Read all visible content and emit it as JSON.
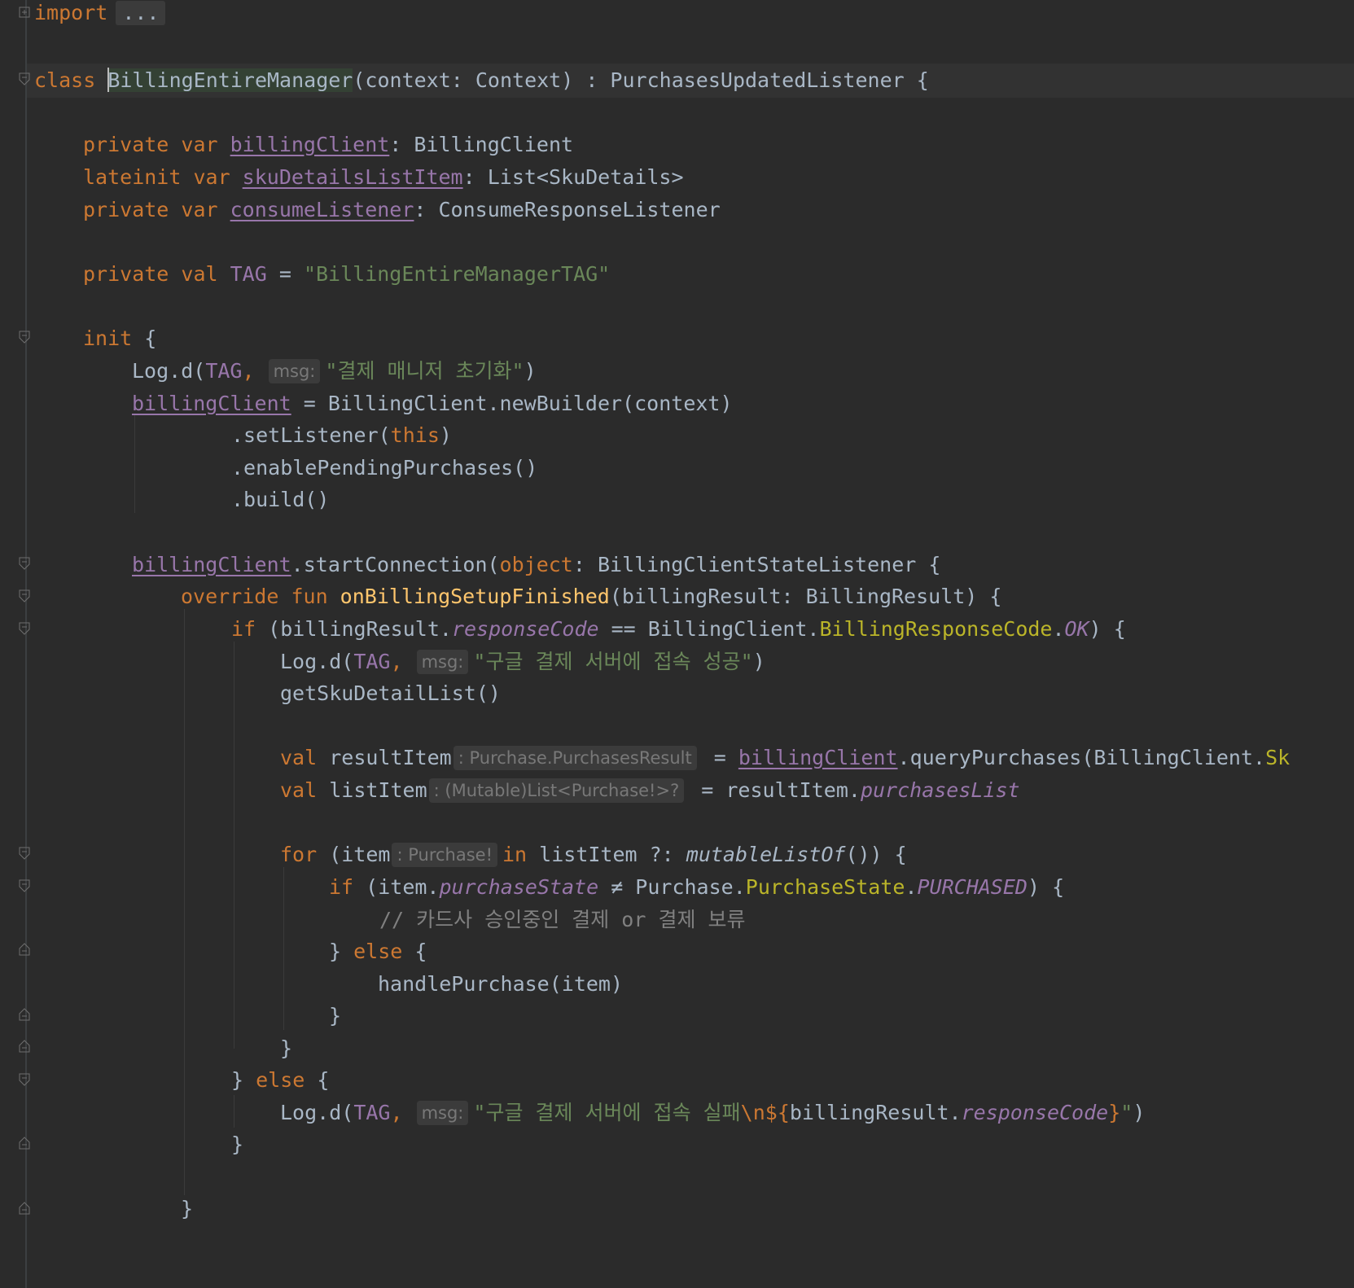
{
  "editor": {
    "language": "Kotlin",
    "lines": {
      "l01": {
        "kw": "import",
        "folded": "..."
      },
      "l02": {
        "kw_class": "class",
        "class_name": "BillingEntireManager",
        "params": "(context: Context) : PurchasesUpdatedListener {"
      },
      "l03": {
        "mod": "private var ",
        "name": "billingClient",
        "rest": ": BillingClient"
      },
      "l04": {
        "mod": "lateinit var ",
        "name": "skuDetailsListItem",
        "rest": ": List<SkuDetails>"
      },
      "l05": {
        "mod": "private var ",
        "name": "consumeListener",
        "rest": ": ConsumeResponseListener"
      },
      "l06": {
        "mod": "private val ",
        "name": "TAG",
        "eq": " = ",
        "str": "\"BillingEntireManagerTAG\""
      },
      "l07": {
        "kw": "init",
        "rest": " {"
      },
      "l08": {
        "pre": "Log.d(",
        "tag": "TAG",
        "comma": ", ",
        "hint": "msg:",
        "str": "\"결제 매니저 초기화\"",
        "post": ")"
      },
      "l09": {
        "name": "billingClient",
        "rest": " = BillingClient.newBuilder(context)"
      },
      "l10": {
        "pre": ".setListener(",
        "kw": "this",
        "post": ")"
      },
      "l11": {
        "text": ".enablePendingPurchases()"
      },
      "l12": {
        "text": ".build()"
      },
      "l13": {
        "name": "billingClient",
        "pre": ".startConnection(",
        "kw": "object",
        "post": ": BillingClientStateListener {"
      },
      "l14": {
        "kw": "override fun ",
        "fn": "onBillingSetupFinished",
        "post": "(billingResult: BillingResult) {"
      },
      "l15": {
        "kw": "if",
        "pre": " (billingResult.",
        "prop": "responseCode",
        "op": " == BillingClient.",
        "inner": "BillingResponseCode",
        "dot": ".",
        "enum": "OK",
        "post": ") {"
      },
      "l16": {
        "pre": "Log.d(",
        "tag": "TAG",
        "comma": ", ",
        "hint": "msg:",
        "str": "\"구글 결제 서버에 접속 성공\"",
        "post": ")"
      },
      "l17": {
        "text": "getSkuDetailList()"
      },
      "l18": {
        "kw": "val ",
        "name": "resultItem",
        "hint": ": Purchase.PurchasesResult",
        "eq": " = ",
        "link": "billingClient",
        "post": ".queryPurchases(BillingClient.",
        "cut": "Sk"
      },
      "l19": {
        "kw": "val ",
        "name": "listItem",
        "hint": ": (Mutable)List<Purchase!>?",
        "eq": " = resultItem.",
        "prop": "purchasesList"
      },
      "l20": {
        "kw": "for",
        "pre": " (item",
        "hint": ": Purchase!",
        "kw2": "in",
        "mid": " listItem ?: ",
        "static": "mutableListOf",
        "post": "()) {"
      },
      "l21": {
        "kw": "if",
        "pre": " (item.",
        "prop": "purchaseState",
        "op": " ≠ Purchase.",
        "inner": "PurchaseState",
        "dot": ".",
        "enum": "PURCHASED",
        "post": ") {"
      },
      "l22": {
        "comment": "// 카드사 승인중인 결제 or 결제 보류"
      },
      "l23": {
        "pre": "} ",
        "kw": "else",
        "post": " {"
      },
      "l24": {
        "text": "handlePurchase(item)"
      },
      "l25": {
        "text": "}"
      },
      "l26": {
        "text": "}"
      },
      "l27": {
        "pre": "} ",
        "kw": "else",
        "post": " {"
      },
      "l28": {
        "pre": "Log.d(",
        "tag": "TAG",
        "comma": ", ",
        "hint": "msg:",
        "str1": "\"구글 결제 서버에 접속 실패",
        "esc": "\\n",
        "tmpl_open": "${",
        "expr": "billingResult.",
        "prop": "responseCode",
        "tmpl_close": "}",
        "str2": "\"",
        "post": ")"
      },
      "l29": {
        "text": "}"
      },
      "l30": {
        "text": "}"
      }
    }
  }
}
